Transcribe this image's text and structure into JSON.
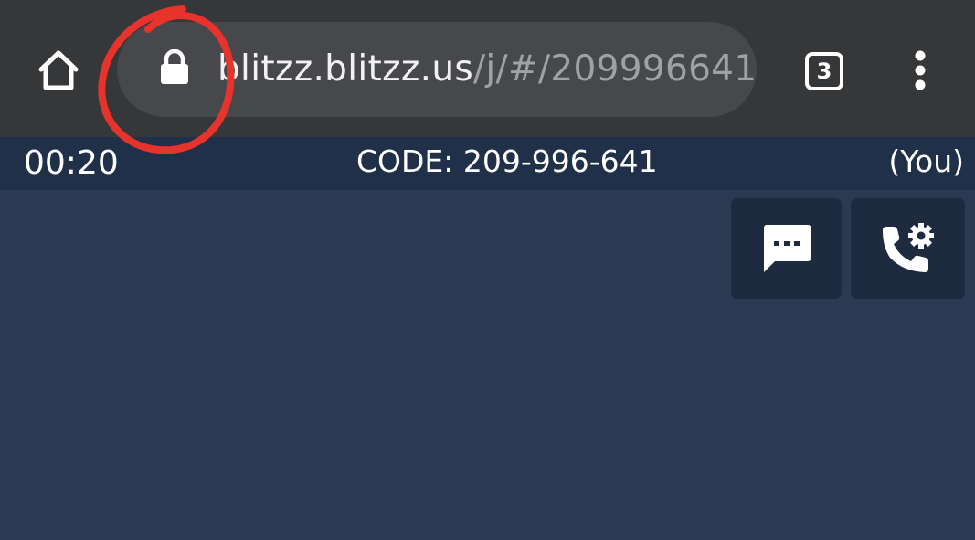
{
  "browser": {
    "url_host": "blitzz.blitzz.us",
    "url_path": "/j/#/209996641",
    "tab_count": "3",
    "icons": {
      "home": "home-icon",
      "lock": "lock-icon",
      "tabs": "tab-switcher-icon",
      "menu": "more-vert-icon"
    }
  },
  "call": {
    "timer": "00:20",
    "code": "CODE: 209-996-641",
    "participant": "(You)",
    "controls": {
      "chat_icon": "chat-bubble-icon",
      "call_settings_icon": "phone-settings-icon"
    }
  },
  "colors": {
    "chrome_bg": "#363739",
    "urlbar_bg": "#46484b",
    "statusbar_bg": "#203048",
    "stage_bg": "#2b3a52",
    "control_bg": "#1d2a3f",
    "annotation": "#e8332d"
  }
}
